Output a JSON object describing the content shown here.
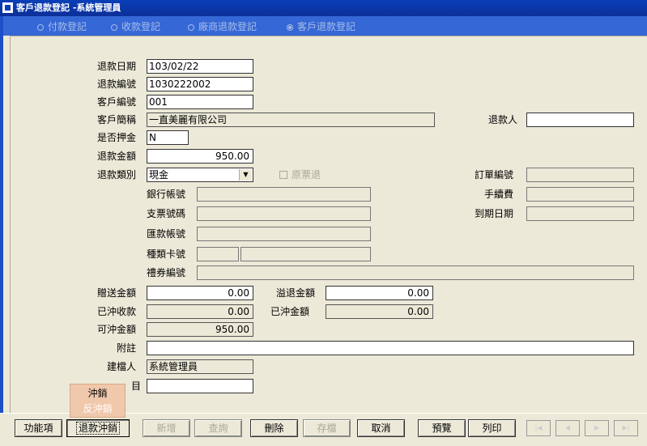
{
  "window": {
    "title": "客戶退款登記 -系統管理員"
  },
  "modes": [
    {
      "label": "付款登記",
      "selected": false
    },
    {
      "label": "收款登記",
      "selected": false
    },
    {
      "label": "廠商退款登記",
      "selected": false
    },
    {
      "label": "客戶退款登記",
      "selected": true
    }
  ],
  "form": {
    "refund_date": {
      "label": "退款日期",
      "value": "103/02/22"
    },
    "refund_no": {
      "label": "退款編號",
      "value": "1030222002"
    },
    "customer_no": {
      "label": "客戶編號",
      "value": "001"
    },
    "customer_name": {
      "label": "客戶簡稱",
      "value": "一直美麗有限公司"
    },
    "refund_person": {
      "label": "退款人",
      "value": ""
    },
    "is_deposit": {
      "label": "是否押金",
      "value": "N"
    },
    "refund_amount": {
      "label": "退款金額",
      "value": "950.00"
    },
    "refund_type": {
      "label": "退款類別",
      "value": "現金"
    },
    "original_ticket": {
      "label": "原票退"
    },
    "order_no": {
      "label": "訂單編號",
      "value": ""
    },
    "bank_account": {
      "label": "銀行帳號",
      "value": ""
    },
    "fee": {
      "label": "手續費",
      "value": ""
    },
    "cheque_no": {
      "label": "支票號碼",
      "value": ""
    },
    "due_date": {
      "label": "到期日期",
      "value": ""
    },
    "remit_account": {
      "label": "匯款帳號",
      "value": ""
    },
    "card_type": {
      "label": "種類卡號",
      "value_a": "",
      "value_b": ""
    },
    "voucher_no": {
      "label": "禮券編號",
      "value": ""
    },
    "gift_amount": {
      "label": "贈送金額",
      "value": "0.00"
    },
    "overflow_amount": {
      "label": "溢退金額",
      "value": "0.00"
    },
    "offset_received": {
      "label": "已沖收款",
      "value": "0.00"
    },
    "offset_amount": {
      "label": "已沖金額",
      "value": "0.00"
    },
    "offsettable_amount": {
      "label": "可沖金額",
      "value": "950.00"
    },
    "note": {
      "label": "附註",
      "value": ""
    },
    "creator": {
      "label": "建檔人",
      "value": "系統管理員"
    },
    "date_suffix": {
      "label_tail": "目",
      "value": ""
    }
  },
  "popup": {
    "items": [
      "沖銷",
      "反沖銷"
    ]
  },
  "toolbar": {
    "function": "功能項",
    "refund_offset": "退款沖銷",
    "add": "新增",
    "query": "查詢",
    "delete": "刪除",
    "save": "存檔",
    "cancel": "取消",
    "preview": "預覽",
    "print": "列印"
  },
  "nav_icons": [
    "first-record-icon",
    "prev-record-icon",
    "next-record-icon",
    "last-record-icon"
  ]
}
